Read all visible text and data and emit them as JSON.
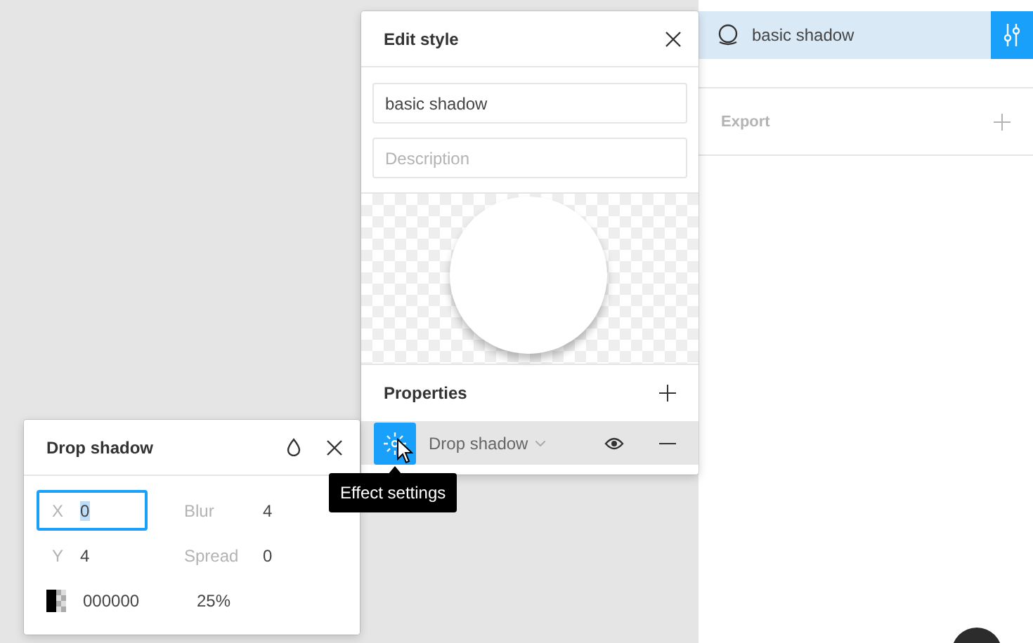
{
  "right_panel": {
    "style_row": {
      "name": "basic shadow",
      "selected": true
    },
    "export": {
      "label": "Export"
    }
  },
  "edit_style": {
    "title": "Edit style",
    "name_value": "basic shadow",
    "description_placeholder": "Description",
    "properties_label": "Properties",
    "effects": [
      {
        "type": "Drop shadow",
        "selected": true,
        "visible": true
      }
    ]
  },
  "tooltip": "Effect settings",
  "drop_shadow": {
    "title": "Drop shadow",
    "fields": [
      {
        "label": "X",
        "value": "0",
        "focused": true
      },
      {
        "label": "Blur",
        "value": "4",
        "focused": false
      },
      {
        "label": "Y",
        "value": "4",
        "focused": false
      },
      {
        "label": "Spread",
        "value": "0",
        "focused": false
      }
    ],
    "color": "000000",
    "opacity": "25%"
  }
}
